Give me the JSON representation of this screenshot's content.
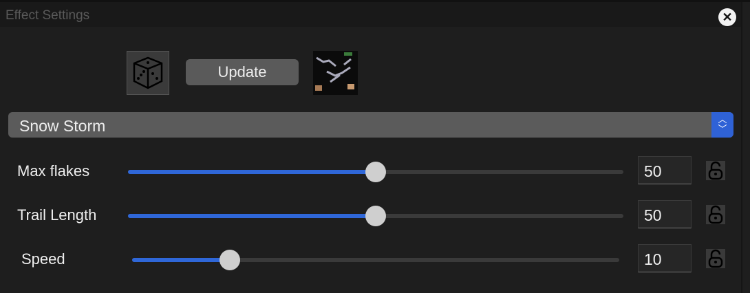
{
  "window": {
    "title": "Effect Settings"
  },
  "toolbar": {
    "update_label": "Update"
  },
  "effect_select": {
    "value": "Snow Storm"
  },
  "params": [
    {
      "label": "Max flakes",
      "value": "50",
      "fraction": 0.5
    },
    {
      "label": "Trail Length",
      "value": "50",
      "fraction": 0.5
    },
    {
      "label": "Speed",
      "value": "10",
      "fraction": 0.2
    }
  ],
  "colors": {
    "accent": "#2f67d8",
    "background": "#1e1e1e"
  }
}
